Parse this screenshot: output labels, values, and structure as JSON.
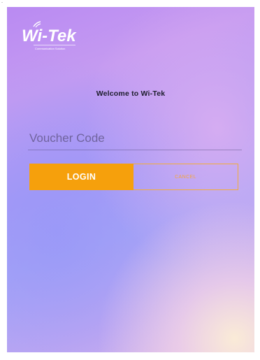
{
  "corner_mark": "-",
  "logo": {
    "text": "Wi-Tek",
    "tagline": "Communication Solution",
    "icon": "wi-tek-logo"
  },
  "welcome_text": "Welcome to Wi-Tek",
  "voucher": {
    "placeholder": "Voucher Code",
    "value": ""
  },
  "buttons": {
    "login_label": "LOGIN",
    "cancel_label": "CANCEL"
  },
  "colors": {
    "accent": "#f6a00c",
    "cancel_text": "#f4a640",
    "background_start": "#b98af2",
    "background_mid": "#a8a6f6"
  }
}
